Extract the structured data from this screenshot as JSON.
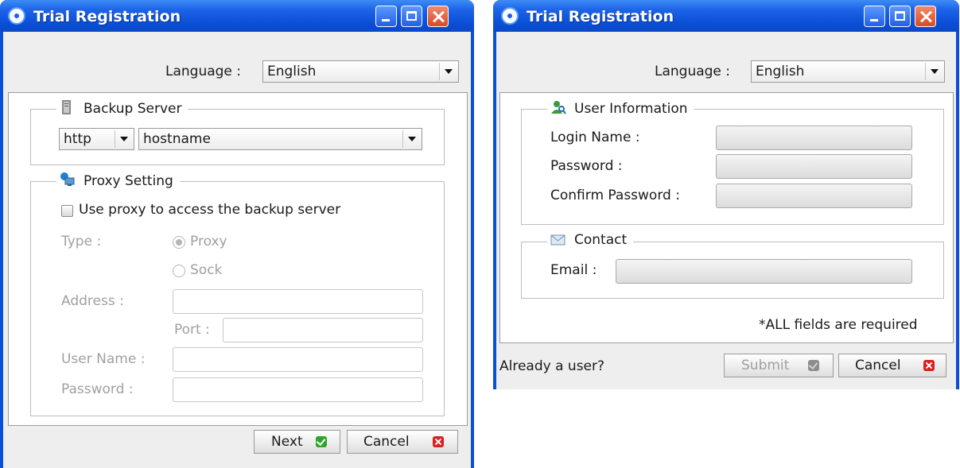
{
  "window1": {
    "title": "Trial Registration",
    "language_label": "Language :",
    "language_value": "English",
    "backup_server": {
      "title": "Backup Server",
      "protocol_value": "http",
      "host_value": "hostname"
    },
    "proxy": {
      "title": "Proxy Setting",
      "use_proxy_label": "Use proxy to access the backup server",
      "type_label": "Type :",
      "option_proxy": "Proxy",
      "option_sock": "Sock",
      "address_label": "Address :",
      "port_label": "Port :",
      "username_label": "User Name :",
      "password_label": "Password :"
    },
    "next_label": "Next",
    "cancel_label": "Cancel"
  },
  "window2": {
    "title": "Trial Registration",
    "language_label": "Language :",
    "language_value": "English",
    "user_info": {
      "title": "User Information",
      "login_label": "Login Name :",
      "password_label": "Password :",
      "confirm_label": "Confirm Password :"
    },
    "contact": {
      "title": "Contact",
      "email_label": "Email :"
    },
    "required_note": "*ALL fields are required",
    "already_user": "Already a user?",
    "submit_label": "Submit",
    "cancel_label": "Cancel"
  },
  "colors": {
    "titlebar": "#1e64e8",
    "client_bg": "#eeeeee",
    "ok_icon": "#2ea52c",
    "cancel_icon": "#d92020"
  },
  "icons": {
    "app": "app-logo-icon",
    "server": "server-icon",
    "proxy": "proxy-computer-icon",
    "user": "user-magnifier-icon",
    "contact": "envelope-icon"
  }
}
